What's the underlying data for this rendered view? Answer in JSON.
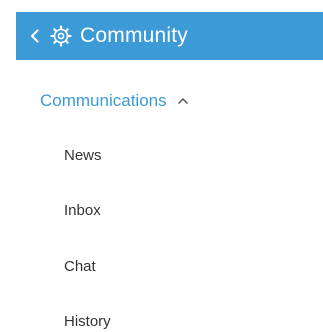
{
  "header": {
    "back_icon": "chevron-left-icon",
    "icon": "gear-icon",
    "title": "Community",
    "background": "#3c9bd7"
  },
  "section": {
    "label": "Communications",
    "expanded": true,
    "chevron_icon": "chevron-up-icon",
    "color": "#3c9bd7"
  },
  "items": [
    {
      "label": "News"
    },
    {
      "label": "Inbox"
    },
    {
      "label": "Chat"
    },
    {
      "label": "History"
    }
  ]
}
